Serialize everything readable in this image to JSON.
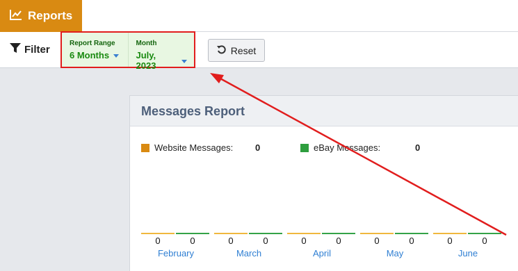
{
  "header": {
    "title": "Reports",
    "icon": "line-chart-icon"
  },
  "filterbar": {
    "filter_label": "Filter",
    "range": {
      "label": "Report Range",
      "value": "6 Months"
    },
    "month": {
      "label": "Month",
      "value": "July, 2023"
    },
    "reset_label": "Reset"
  },
  "report": {
    "title": "Messages Report",
    "legend": [
      {
        "label": "Website Messages:",
        "value": "0",
        "color": "#d98a12"
      },
      {
        "label": "eBay Messages:",
        "value": "0",
        "color": "#2e9e3e"
      }
    ],
    "chart_data": {
      "type": "bar",
      "categories": [
        "February",
        "March",
        "April",
        "May",
        "June"
      ],
      "series": [
        {
          "name": "Website Messages",
          "values": [
            0,
            0,
            0,
            0,
            0
          ]
        },
        {
          "name": "eBay Messages",
          "values": [
            0,
            0,
            0,
            0,
            0
          ]
        }
      ],
      "data_labels": [
        "0",
        "0",
        "0",
        "0",
        "0",
        "0",
        "0",
        "0",
        "0",
        "0"
      ]
    }
  },
  "colors": {
    "accent": "#d98a12",
    "highlight": "#e11d1d",
    "link": "#2f7fd3",
    "website": "#f0b73e",
    "ebay": "#34a347"
  }
}
